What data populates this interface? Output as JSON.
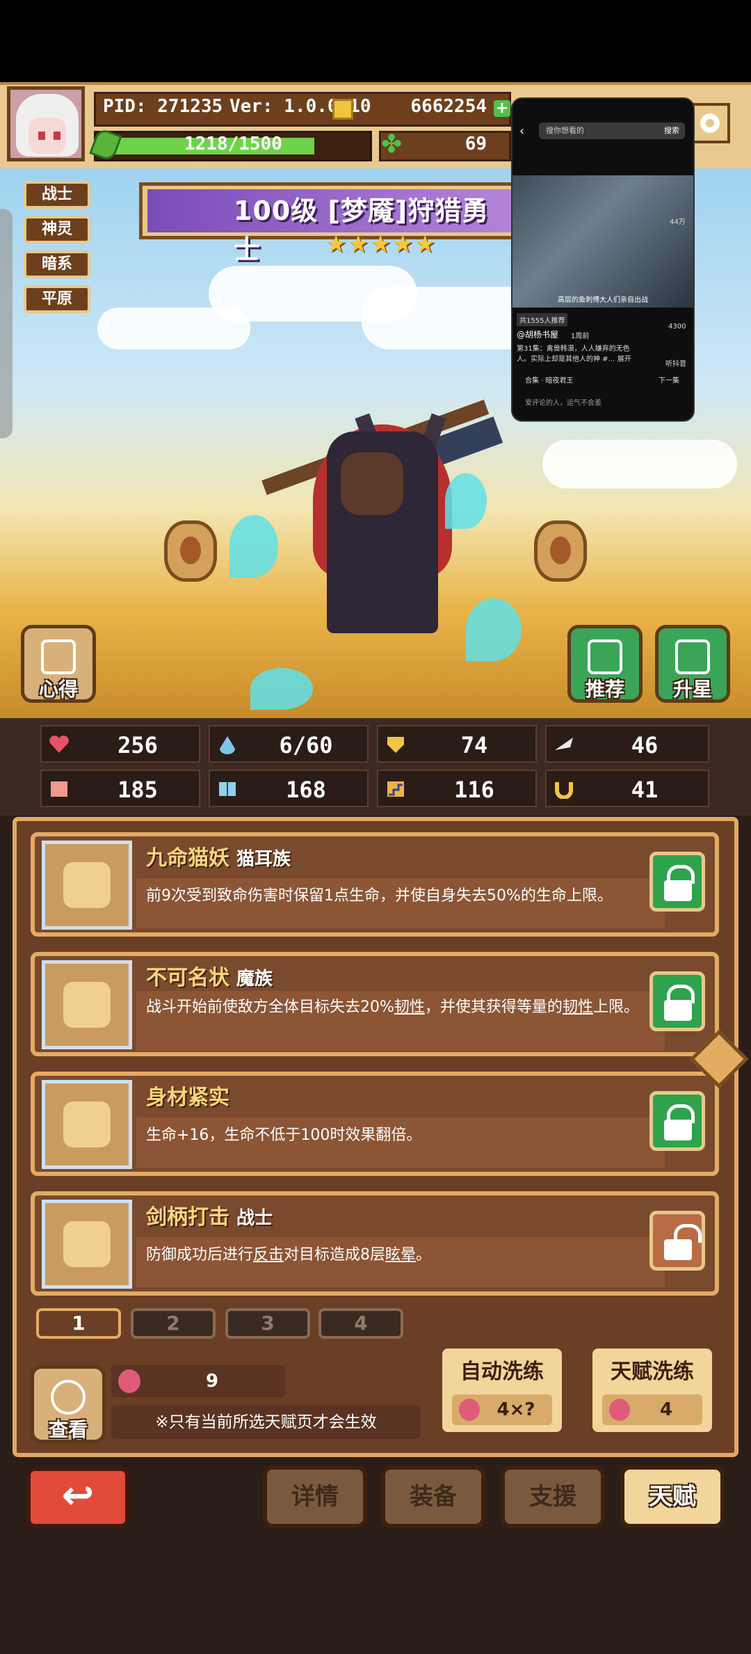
{
  "header": {
    "pid": "PID: 271235",
    "version": "Ver: 1.0.0.10",
    "coins": "6662254",
    "xp": "1218/1500",
    "xp_fraction": 0.812,
    "clovers": "69"
  },
  "popup": {
    "search_placeholder": "搜你想看的",
    "search_button": "搜索",
    "video_caption": "高层的鱼刺傅大人们亲自出战",
    "likes_count": "44万",
    "shares_count": "4300",
    "recommend": "共1555人推荐",
    "author": "@胡杨书屋",
    "time": "1周前",
    "desc": "第31集：禽兽韩漠，人人嫌弃的无色人。实际上却是其他人的神 #… 展开",
    "listen": "听抖音",
    "collection": "合集 · 暗夜君王",
    "next": "下一集",
    "comment_placeholder": "爱评论的人，运气不会差"
  },
  "tags": [
    "战士",
    "神灵",
    "暗系",
    "平原"
  ],
  "hero": {
    "title": "100级 [梦魇]狩猎勇士",
    "stars": 5
  },
  "actions": {
    "insight": "心得",
    "recommend": "推荐",
    "star_up": "升星"
  },
  "stats": [
    {
      "icon": "heart-icon",
      "value": "256"
    },
    {
      "icon": "drop-icon",
      "value": "6/60"
    },
    {
      "icon": "shield-icon",
      "value": "74"
    },
    {
      "icon": "wing-icon",
      "value": "46"
    },
    {
      "icon": "fist-icon",
      "value": "185"
    },
    {
      "icon": "book-icon",
      "value": "168"
    },
    {
      "icon": "stairs-icon",
      "value": "116"
    },
    {
      "icon": "horseshoe-icon",
      "value": "41"
    }
  ],
  "talents": [
    {
      "name": "九命猫妖",
      "sub": "猫耳族",
      "desc_a": "前9次受到致命伤害时保留1点生命，并使自身失去50%的生命上限。",
      "kw1": "",
      "desc_b": "",
      "kw2": "",
      "desc_c": "",
      "locked": true
    },
    {
      "name": "不可名状",
      "sub": "魔族",
      "desc_a": "战斗开始前使敌方全体目标失去20%",
      "kw1": "韧性",
      "desc_b": "，并使其获得等量的",
      "kw2": "韧性",
      "desc_c": "上限。",
      "locked": true
    },
    {
      "name": "身材紧实",
      "sub": "",
      "desc_a": "生命+16，生命不低于100时效果翻倍。",
      "kw1": "",
      "desc_b": "",
      "kw2": "",
      "desc_c": "",
      "locked": true
    },
    {
      "name": "剑柄打击",
      "sub": "战士",
      "desc_a": "防御成功后进行",
      "kw1": "反击",
      "desc_b": "对目标造成8层",
      "kw2": "眩晕",
      "desc_c": "。",
      "locked": false
    }
  ],
  "pages": [
    "1",
    "2",
    "3",
    "4"
  ],
  "bottom": {
    "view": "查看",
    "fruit_count": "9",
    "note": "※只有当前所选天赋页才会生效",
    "auto_wash": "自动洗练",
    "auto_wash_cost": "4×?",
    "talent_wash": "天赋洗练",
    "talent_wash_cost": "4"
  },
  "nav": [
    "详情",
    "装备",
    "支援",
    "天赋"
  ],
  "colors": {
    "accent": "#e4ac63",
    "lock_green": "#2fa24c",
    "banner_purple": "#9a6ac8"
  }
}
